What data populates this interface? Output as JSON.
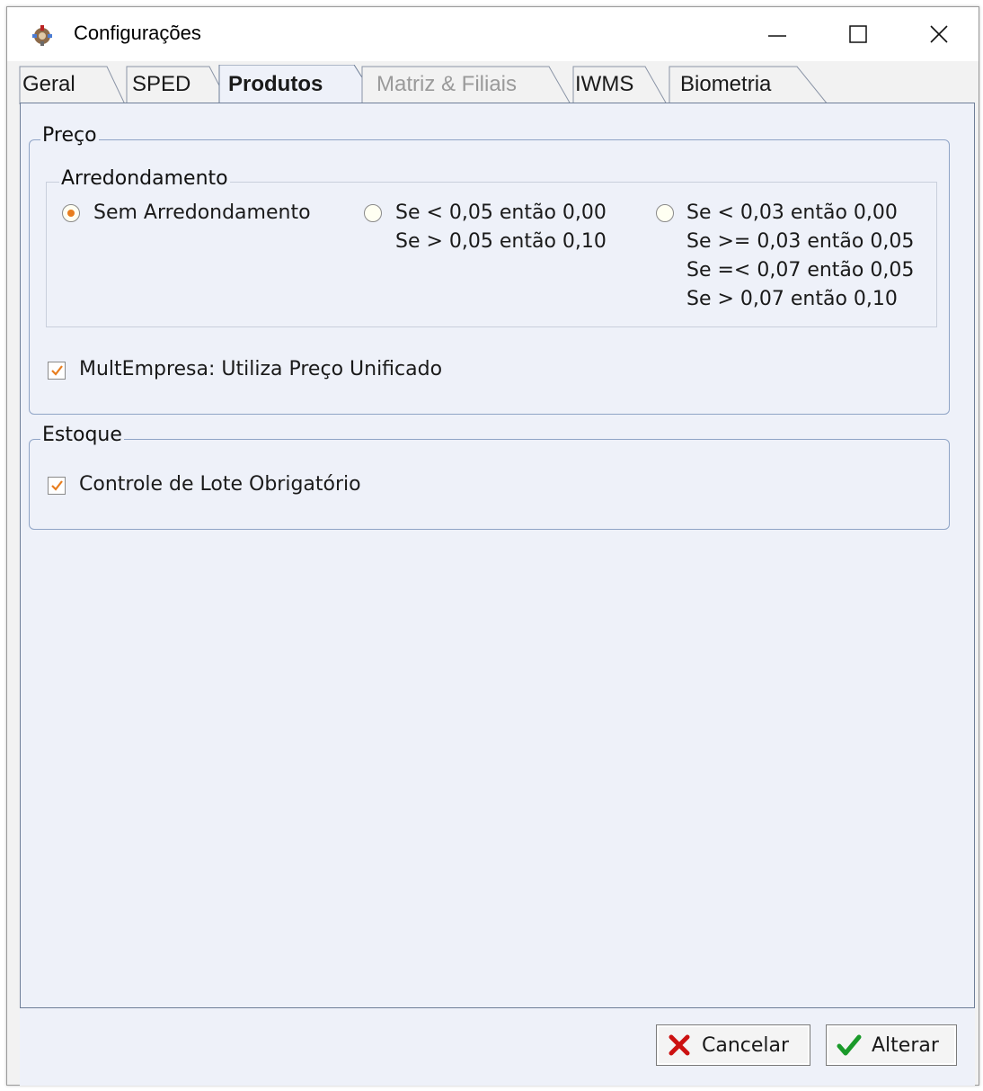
{
  "window": {
    "title": "Configurações",
    "icon": "gear-app-icon"
  },
  "tabs": [
    {
      "label": "Geral",
      "state": "normal"
    },
    {
      "label": "SPED",
      "state": "normal"
    },
    {
      "label": "Produtos",
      "state": "active"
    },
    {
      "label": "Matriz & Filiais",
      "state": "disabled"
    },
    {
      "label": "IWMS",
      "state": "normal"
    },
    {
      "label": "Biometria",
      "state": "normal"
    }
  ],
  "preco": {
    "title": "Preço",
    "arredondamento": {
      "title": "Arredondamento",
      "options": [
        {
          "lines": [
            "Sem Arredondamento"
          ],
          "checked": true
        },
        {
          "lines": [
            "Se < 0,05 então 0,00",
            "Se > 0,05 então 0,10"
          ],
          "checked": false
        },
        {
          "lines": [
            "Se < 0,03 então 0,00",
            "Se >= 0,03 então 0,05",
            "Se =< 0,07 então 0,05",
            "Se > 0,07 então 0,10"
          ],
          "checked": false
        }
      ]
    },
    "multempresa": {
      "label": "MultEmpresa: Utiliza Preço Unificado",
      "checked": true
    }
  },
  "estoque": {
    "title": "Estoque",
    "controle_lote": {
      "label": "Controle de Lote Obrigatório",
      "checked": true
    }
  },
  "buttons": {
    "cancel": "Cancelar",
    "ok": "Alterar"
  },
  "colors": {
    "accent": "#e87d1e",
    "cancel_icon": "#cc1111",
    "ok_icon": "#1a9a2a",
    "page_bg": "#eef1f9",
    "group_border": "#8fa4c6"
  }
}
